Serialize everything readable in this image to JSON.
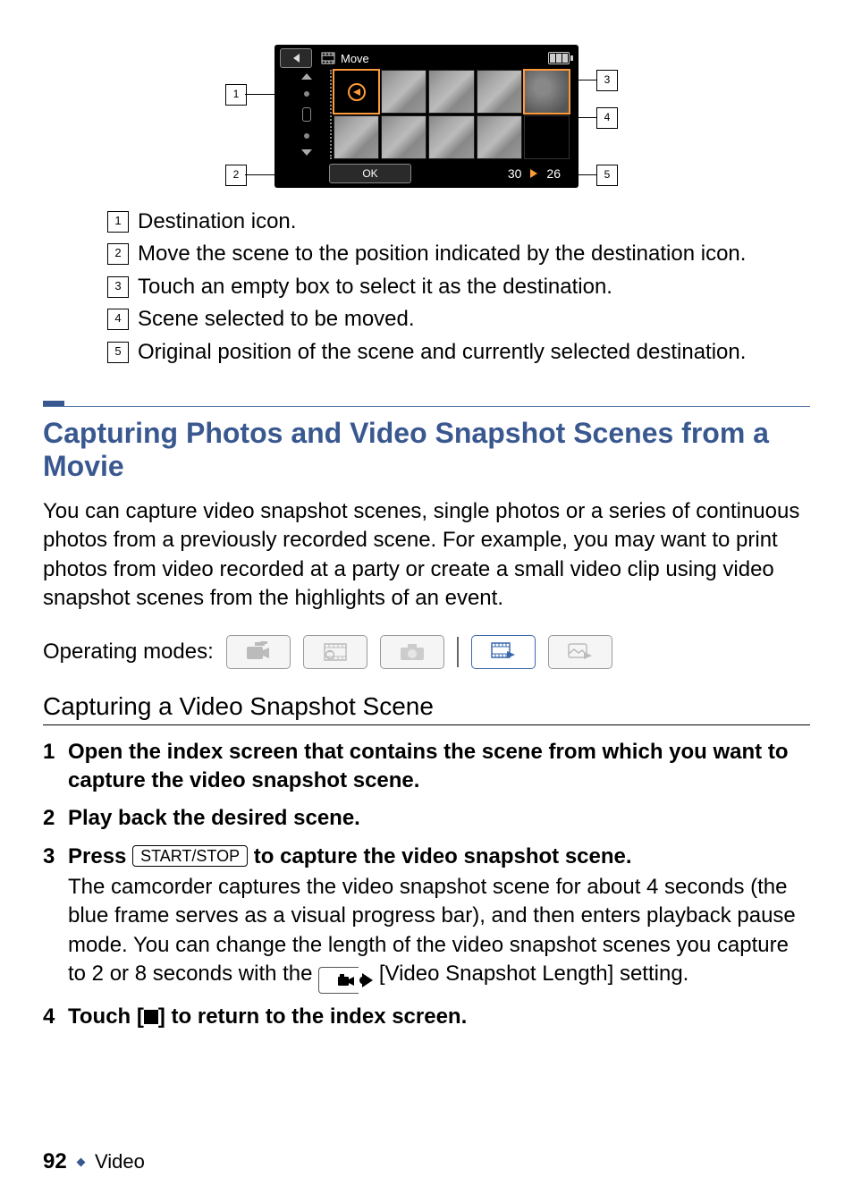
{
  "figure": {
    "header_title": "Move",
    "ok_label": "OK",
    "position_from": "30",
    "position_to": "26",
    "callouts": {
      "c1": "1",
      "c2": "2",
      "c3": "3",
      "c4": "4",
      "c5": "5"
    }
  },
  "legend": [
    {
      "num": "1",
      "text": "Destination icon."
    },
    {
      "num": "2",
      "text": "Move the scene to the position indicated by the destination icon."
    },
    {
      "num": "3",
      "text": "Touch an empty box to select it as the destination."
    },
    {
      "num": "4",
      "text": "Scene selected to be moved."
    },
    {
      "num": "5",
      "text": "Original position of the scene and currently selected destination."
    }
  ],
  "section_title": "Capturing Photos and Video Snapshot Scenes from a Movie",
  "section_intro": "You can capture video snapshot scenes, single photos or a series of continuous photos from a previously recorded scene. For example, you may want to print photos from video recorded at a party or create a small video clip using video snapshot scenes from the highlights of an event.",
  "operating_modes_label": "Operating modes:",
  "subheading": "Capturing a Video Snapshot Scene",
  "steps": {
    "s1": {
      "num": "1",
      "head": "Open the index screen that contains the scene from which you want to capture the video snapshot scene."
    },
    "s2": {
      "num": "2",
      "head": "Play back the desired scene."
    },
    "s3": {
      "num": "3",
      "head_before": "Press ",
      "key": "START/STOP",
      "head_after": " to capture the video snapshot scene.",
      "desc_prefix": "The camcorder captures the video snapshot scene for about 4 seconds (the blue frame serves as a visual progress bar), and then enters playback pause mode. You can change the length of the video snapshot scenes you capture to 2 or 8 seconds with the ",
      "desc_suffix": " [Video Snapshot Length] setting."
    },
    "s4": {
      "num": "4",
      "prefix": "Touch [",
      "suffix": "] to return to the index screen."
    }
  },
  "footer": {
    "page": "92",
    "section": "Video"
  }
}
